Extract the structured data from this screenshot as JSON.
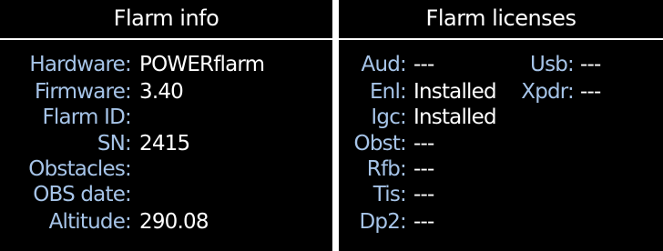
{
  "flarm_info": {
    "title": "Flarm info",
    "fields": [
      {
        "label": "Hardware:",
        "value": "POWERflarm"
      },
      {
        "label": "Firmware:",
        "value": "3.40"
      },
      {
        "label": "Flarm ID:",
        "value": ""
      },
      {
        "label": "SN:",
        "value": "2415"
      },
      {
        "label": "Obstacles:",
        "value": ""
      },
      {
        "label": "OBS date:",
        "value": ""
      },
      {
        "label": "Altitude:",
        "value": "290.08"
      }
    ]
  },
  "flarm_licenses": {
    "title": "Flarm licenses",
    "left_fields": [
      {
        "label": "Aud:",
        "value": "---"
      },
      {
        "label": "Enl:",
        "value": "Installed"
      },
      {
        "label": "Igc:",
        "value": "Installed"
      },
      {
        "label": "Obst:",
        "value": "---"
      },
      {
        "label": "Rfb:",
        "value": "---"
      },
      {
        "label": "Tis:",
        "value": "---"
      },
      {
        "label": "Dp2:",
        "value": "---"
      }
    ],
    "right_fields": [
      {
        "label": "Usb:",
        "value": "---"
      },
      {
        "label": "Xpdr:",
        "value": "---"
      }
    ]
  },
  "colors": {
    "background": "#000000",
    "label": "#a6c4e8",
    "value": "#ffffff",
    "divider": "#ffffff"
  }
}
